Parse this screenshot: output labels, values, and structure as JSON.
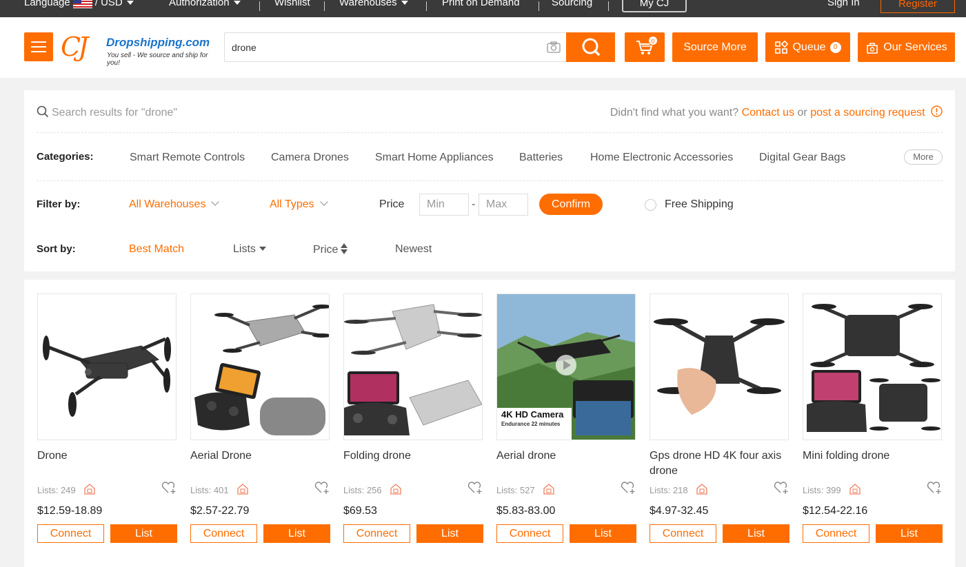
{
  "topbar": {
    "language": "Language",
    "currency": "/ USD",
    "authorization": "Authorization",
    "wishlist": "Wishlist",
    "warehouses": "Warehouses",
    "print_on_demand": "Print on Demand",
    "sourcing": "Sourcing",
    "my_cj": "My CJ",
    "sign_in": "Sign In",
    "register": "Register"
  },
  "header": {
    "logo_mark": "CJ",
    "logo_name": "Dropshipping.com",
    "logo_tagline": "You sell - We source and ship for you!",
    "search_value": "drone",
    "cart_count": "0",
    "source_more": "Source More",
    "queue": "Queue",
    "queue_count": "0",
    "our_services": "Our Services",
    "accent_color": "#ff6d00"
  },
  "filters": {
    "search_results": "Search results for \"drone\"",
    "didnt_find": "Didn't find what you want?",
    "contact_us": "Contact us",
    "or": "or",
    "post_request": "post a sourcing request",
    "categories_label": "Categories:",
    "categories": [
      "Smart Remote Controls",
      "Camera Drones",
      "Smart Home Appliances",
      "Batteries",
      "Home Electronic Accessories",
      "Digital Gear Bags"
    ],
    "more": "More",
    "filter_label": "Filter by:",
    "all_warehouses": "All Warehouses",
    "all_types": "All Types",
    "price_label": "Price",
    "min_placeholder": "Min",
    "dash": "-",
    "max_placeholder": "Max",
    "confirm": "Confirm",
    "free_shipping": "Free Shipping",
    "sort_label": "Sort by:",
    "sort_best_match": "Best Match",
    "sort_lists": "Lists",
    "sort_price": "Price",
    "sort_newest": "Newest"
  },
  "products": [
    {
      "title": "Drone",
      "lists": "Lists: 249",
      "price": "$12.59-18.89",
      "connect": "Connect",
      "list": "List"
    },
    {
      "title": "Aerial Drone",
      "lists": "Lists: 401",
      "price": "$2.57-22.79",
      "connect": "Connect",
      "list": "List"
    },
    {
      "title": "Folding drone",
      "lists": "Lists: 256",
      "price": "$69.53",
      "connect": "Connect",
      "list": "List"
    },
    {
      "title": "Aerial drone",
      "lists": "Lists: 527",
      "price": "$5.83-83.00",
      "connect": "Connect",
      "list": "List",
      "image_caption": "4K HD Camera",
      "image_subcaption": "Endurance 22 minutes"
    },
    {
      "title": "Gps drone HD 4K four axis drone",
      "lists": "Lists: 218",
      "price": "$4.97-32.45",
      "connect": "Connect",
      "list": "List"
    },
    {
      "title": "Mini folding drone",
      "lists": "Lists: 399",
      "price": "$12.54-22.16",
      "connect": "Connect",
      "list": "List"
    }
  ]
}
